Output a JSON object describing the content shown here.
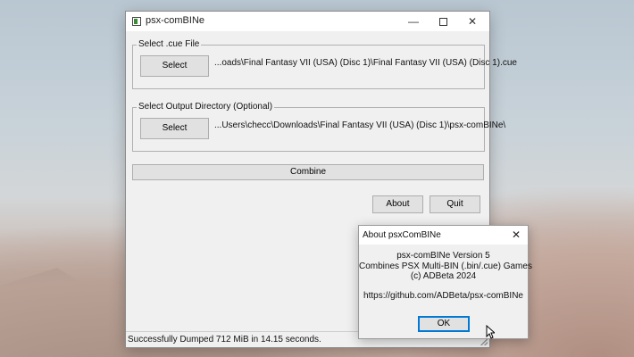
{
  "window": {
    "title": "psx-comBINe",
    "minimize": "—",
    "close": "✕"
  },
  "cue_group": {
    "legend": "Select .cue File",
    "select_label": "Select",
    "path": "...oads\\Final Fantasy VII (USA) (Disc 1)\\Final Fantasy VII (USA) (Disc 1).cue"
  },
  "output_group": {
    "legend": "Select Output Directory (Optional)",
    "select_label": "Select",
    "path": "...Users\\checc\\Downloads\\Final Fantasy VII (USA) (Disc 1)\\psx-comBINe\\"
  },
  "actions": {
    "combine": "Combine",
    "about": "About",
    "quit": "Quit"
  },
  "status": {
    "text": "Successfully Dumped 712 MiB in 14.15 seconds."
  },
  "about_dialog": {
    "title": "About psxComBINe",
    "close": "✕",
    "version": "psx-comBINe Version 5",
    "description": "Combines PSX Multi-BIN (.bin/.cue) Games",
    "copyright": "(c) ADBeta 2024",
    "url": "https://github.com/ADBeta/psx-comBINe",
    "ok_label": "OK"
  },
  "colors": {
    "window_bg": "#f0f0f0",
    "button_bg": "#e1e1e1",
    "focus_border": "#0078d4"
  },
  "icons": {
    "app": "window-app-icon",
    "cursor": "arrow-cursor-icon"
  }
}
